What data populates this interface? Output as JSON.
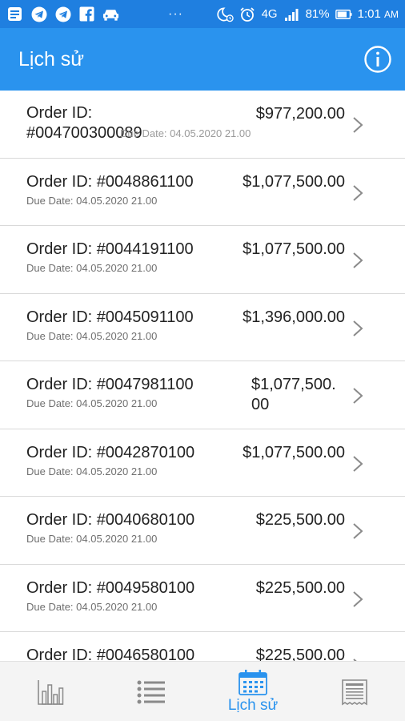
{
  "status_bar": {
    "icons_left": [
      "news-icon",
      "telegram-icon",
      "telegram-icon",
      "facebook-icon",
      "car-icon"
    ],
    "more": "···",
    "network": "4G",
    "battery": "81%",
    "time": "1:01",
    "ampm": "AM"
  },
  "header": {
    "title": "Lịch sử",
    "info_icon": "info-icon"
  },
  "orders": [
    {
      "order": "Order ID:",
      "order2": "#004700300089",
      "due": "Due Date: 04.05.2020 21.00",
      "amount": "$977,200.00",
      "amount2": ""
    },
    {
      "order": "Order ID: #0048861100",
      "order2": "",
      "due": "Due Date: 04.05.2020 21.00",
      "amount": "$1,077,500.00",
      "amount2": ""
    },
    {
      "order": "Order ID: #0044191100",
      "order2": "",
      "due": "Due Date: 04.05.2020 21.00",
      "amount": "$1,077,500.00",
      "amount2": ""
    },
    {
      "order": "Order ID: #0045091100",
      "order2": "",
      "due": "Due Date: 04.05.2020 21.00",
      "amount": "$1,396,000.00",
      "amount2": ""
    },
    {
      "order": "Order ID: #0047981100",
      "order2": "",
      "due": "Due Date: 04.05.2020 21.00",
      "amount": "$1,077,500.",
      "amount2": "00"
    },
    {
      "order": "Order ID: #0042870100",
      "order2": "",
      "due": "Due Date: 04.05.2020 21.00",
      "amount": "$1,077,500.00",
      "amount2": ""
    },
    {
      "order": "Order ID: #0040680100",
      "order2": "",
      "due": "Due Date: 04.05.2020 21.00",
      "amount": "$225,500.00",
      "amount2": ""
    },
    {
      "order": "Order ID: #0049580100",
      "order2": "",
      "due": "Due Date: 04.05.2020 21.00",
      "amount": "$225,500.00",
      "amount2": ""
    },
    {
      "order": "Order ID: #0046580100",
      "order2": "",
      "due": "",
      "amount": "$225,500.00",
      "amount2": ""
    }
  ],
  "bottom_nav": {
    "items": [
      {
        "icon": "bar-chart-icon",
        "label": ""
      },
      {
        "icon": "list-icon",
        "label": ""
      },
      {
        "icon": "calendar-icon",
        "label": "Lịch sử"
      },
      {
        "icon": "receipt-icon",
        "label": ""
      }
    ],
    "active_color": "#2a93ee",
    "inactive_color": "#8a8a8a"
  },
  "colors": {
    "status_bar": "#1f7fe0",
    "app_bar": "#2a93ee"
  }
}
